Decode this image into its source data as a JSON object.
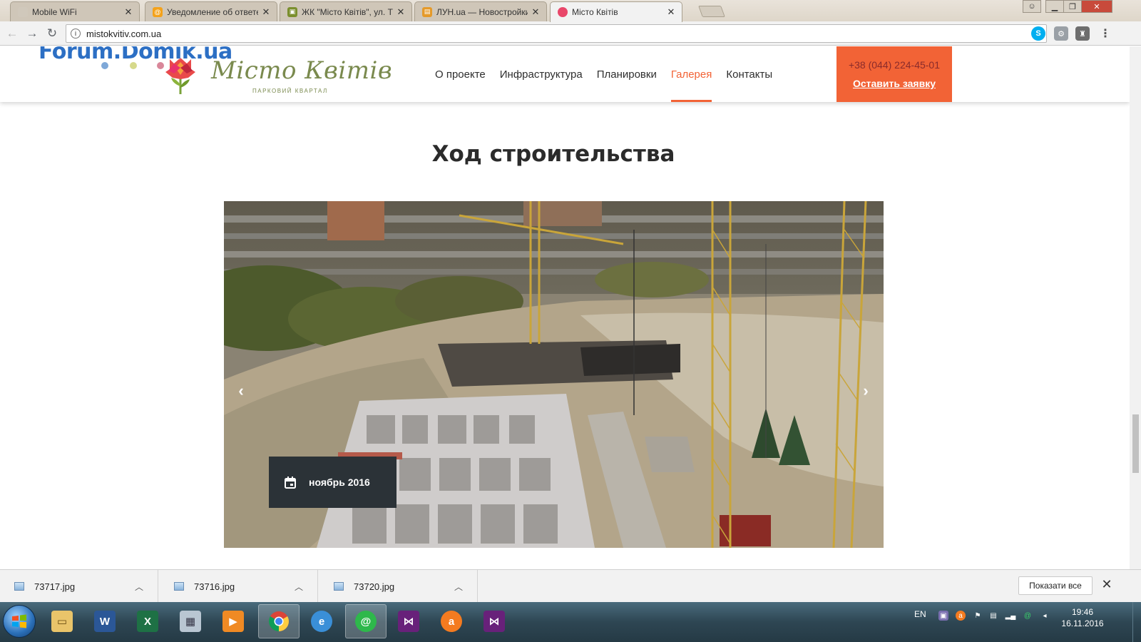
{
  "browser": {
    "tabs": [
      {
        "title": "Mobile WiFi",
        "favicon": "globe-icon",
        "active": false
      },
      {
        "title": "Уведомление об ответе",
        "favicon": "mail-at-icon",
        "active": false
      },
      {
        "title": "ЖК \"Місто Квітів\", ул. Ти",
        "favicon": "forum-icon",
        "active": false
      },
      {
        "title": "ЛУН.ua — Новостройки",
        "favicon": "lun-icon",
        "active": false
      },
      {
        "title": "Місто Квітів",
        "favicon": "flower-icon",
        "active": true
      }
    ],
    "url": "mistokvitiv.com.ua",
    "bookmarked": true
  },
  "site": {
    "watermark": "Forum.Domik.ua",
    "brand": {
      "name": "Місто Квітів",
      "subtitle": "ПАРКОВИЙ КВАРТАЛ"
    },
    "nav": [
      {
        "label": "О проекте",
        "active": false
      },
      {
        "label": "Инфраструктура",
        "active": false
      },
      {
        "label": "Планировки",
        "active": false
      },
      {
        "label": "Галерея",
        "active": true
      },
      {
        "label": "Контакты",
        "active": false
      }
    ],
    "cta": {
      "phone": "+38 (044) 224-45-01",
      "link": "Оставить заявку"
    },
    "section_title": "Ход строительства",
    "slide": {
      "date": "ноябрь 2016",
      "image": "construction-site-aerial-photo"
    },
    "colors": {
      "accent": "#f26336",
      "brand_green": "#7a8a4e",
      "badge_bg": "#2b3237"
    }
  },
  "downloads": {
    "items": [
      {
        "name": "73717.jpg"
      },
      {
        "name": "73716.jpg"
      },
      {
        "name": "73720.jpg"
      }
    ],
    "show_all": "Показати все"
  },
  "taskbar": {
    "language": "EN",
    "time": "19:46",
    "date": "16.11.2016"
  }
}
